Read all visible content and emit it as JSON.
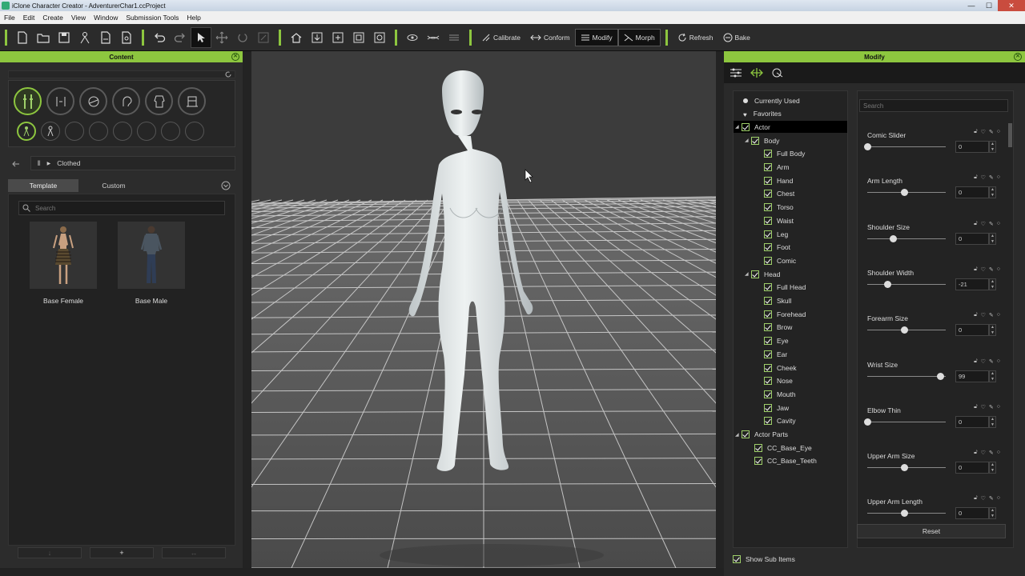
{
  "window": {
    "title": "iClone Character Creator - AdventurerChar1.ccProject"
  },
  "menu": [
    "File",
    "Edit",
    "Create",
    "View",
    "Window",
    "Submission Tools",
    "Help"
  ],
  "toolbar": {
    "calibrate": "Calibrate",
    "conform": "Conform",
    "modify": "Modify",
    "morph": "Morph",
    "refresh": "Refresh",
    "bake": "Bake"
  },
  "content": {
    "title": "Content",
    "breadcrumb": "Clothed",
    "tabs": [
      "Template",
      "Custom"
    ],
    "search_placeholder": "Search",
    "items": [
      {
        "label": "Base Female"
      },
      {
        "label": "Base Male"
      }
    ]
  },
  "modify": {
    "title": "Modify",
    "search_placeholder": "Search",
    "tree": [
      "Currently Used",
      "Favorites",
      "Actor",
      "Body",
      "Full Body",
      "Arm",
      "Hand",
      "Chest",
      "Torso",
      "Waist",
      "Leg",
      "Foot",
      "Comic",
      "Head",
      "Full Head",
      "Skull",
      "Forehead",
      "Brow",
      "Eye",
      "Ear",
      "Cheek",
      "Nose",
      "Mouth",
      "Jaw",
      "Cavity",
      "Actor Parts",
      "CC_Base_Eye",
      "CC_Base_Teeth"
    ],
    "sliders": [
      {
        "name": "Comic Slider",
        "value": "0",
        "pos": 0.0
      },
      {
        "name": "Arm Length",
        "value": "0",
        "pos": 0.5
      },
      {
        "name": "Shoulder Size",
        "value": "0",
        "pos": 0.35
      },
      {
        "name": "Shoulder Width",
        "value": "-21",
        "pos": 0.27
      },
      {
        "name": "Forearm Size",
        "value": "0",
        "pos": 0.5
      },
      {
        "name": "Wrist Size",
        "value": "99",
        "pos": 0.99
      },
      {
        "name": "Elbow Thin",
        "value": "0",
        "pos": 0.0
      },
      {
        "name": "Upper Arm Size",
        "value": "0",
        "pos": 0.5
      },
      {
        "name": "Upper Arm Length",
        "value": "0",
        "pos": 0.5
      }
    ],
    "reset_label": "Reset",
    "show_sub_items": "Show Sub Items"
  }
}
